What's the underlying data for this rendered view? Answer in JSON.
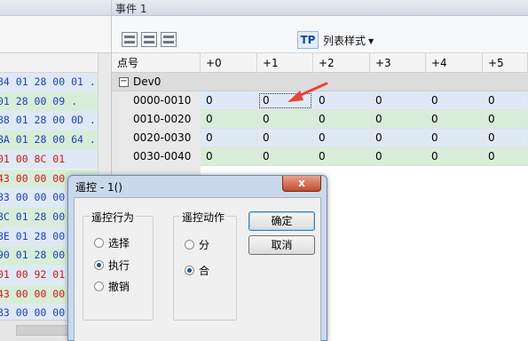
{
  "panel_title": "事件 1",
  "toolbar": {
    "icons": [
      "grid-icon",
      "grid-icon",
      "grid-icon"
    ],
    "tp_label": "TP",
    "style_label": "列表样式"
  },
  "table": {
    "columns": [
      "点号",
      "+0",
      "+1",
      "+2",
      "+3",
      "+4",
      "+5"
    ],
    "group": "Dev0",
    "rows": [
      {
        "label": "0000-0010",
        "values": [
          "0",
          "0",
          "0",
          "0",
          "0",
          "0"
        ]
      },
      {
        "label": "0010-0020",
        "values": [
          "0",
          "0",
          "0",
          "0",
          "0",
          "0"
        ]
      },
      {
        "label": "0020-0030",
        "values": [
          "0",
          "0",
          "0",
          "0",
          "0",
          "0"
        ]
      },
      {
        "label": "0030-0040",
        "values": [
          "0",
          "0",
          "0",
          "0",
          "0",
          "0"
        ]
      }
    ]
  },
  "left_hex": [
    {
      "text": "84 01 28 00 01 .",
      "color": "#1f3fbf"
    },
    {
      "text": "01 28 00 09 .",
      "color": "#1f3fbf"
    },
    {
      "text": "88 01 28 00 0D .",
      "color": "#1f3fbf"
    },
    {
      "text": "8A 01 28 00 64 .",
      "color": "#1f3fbf"
    },
    {
      "text": "01 00 8C 01",
      "color": "#d01818"
    },
    {
      "text": "43 00 00 00",
      "color": "#d01818"
    },
    {
      "text": "83 00 00 00",
      "color": "#1f3fbf"
    },
    {
      "text": "8C 01 28 00 0 .",
      "color": "#1f3fbf"
    },
    {
      "text": "8E 01 28 00 0 .",
      "color": "#1f3fbf"
    },
    {
      "text": "90 01 28 00 0 .",
      "color": "#1f3fbf"
    },
    {
      "text": "01 00 92 01",
      "color": "#d01818"
    },
    {
      "text": "43 00 00 00",
      "color": "#d01818"
    },
    {
      "text": "83 00 00 00",
      "color": "#1f3fbf"
    }
  ],
  "dialog": {
    "title": "遥控 - 1()",
    "close_label": "x",
    "action_group": {
      "title": "遥控行为",
      "options": [
        "选择",
        "执行",
        "撤销"
      ],
      "selected_index": 1
    },
    "motion_group": {
      "title": "遥控动作",
      "options": [
        "分",
        "合"
      ],
      "selected_index": 1
    },
    "ok_label": "确定",
    "cancel_label": "取消"
  },
  "colors": {
    "row_even": "#dfe9f6",
    "row_odd": "#d8edd8",
    "hex_blue": "#1f3fbf",
    "hex_red": "#d01818",
    "arrow": "#e8443a"
  }
}
